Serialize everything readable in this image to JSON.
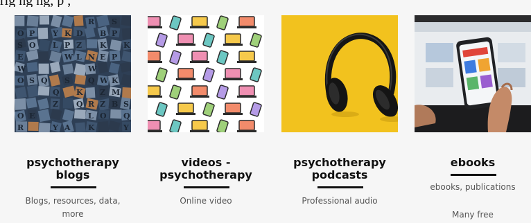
{
  "page": {
    "top_text_fragment": "rig  ng              ng, p       ,"
  },
  "cards": [
    {
      "title": "psychotherapy\nblogs",
      "description": "Blogs, resources, data,\nmore",
      "image_subject": "wooden letterpress type blocks"
    },
    {
      "title": "videos -\npsychotherapy",
      "description": "Online video",
      "image_subject": "pattern of laptops and tablets"
    },
    {
      "title": "psychotherapy\npodcasts",
      "description": "Professional audio",
      "image_subject": "black headphones on yellow background"
    },
    {
      "title": "ebooks",
      "description": "ebooks, publications",
      "description_secondary": "Many free",
      "image_subject": "hand holding smartphone in front of laptop"
    }
  ],
  "colors": {
    "background": "#f6f6f6",
    "title": "#111111",
    "underline": "#111111",
    "description": "#555555",
    "podcast_yellow": "#f2c21e"
  }
}
